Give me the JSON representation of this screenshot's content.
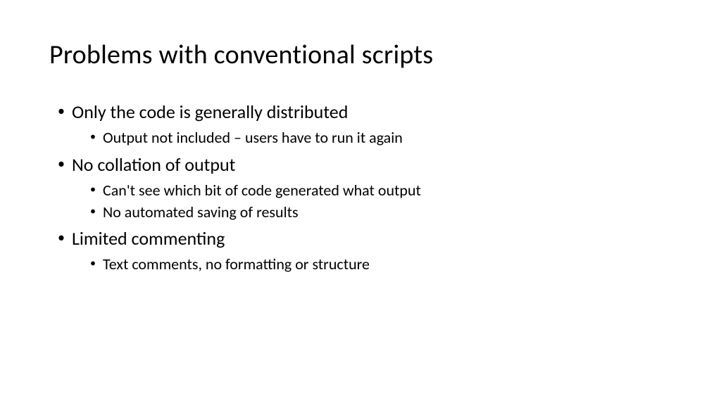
{
  "slide": {
    "title": "Problems with conventional scripts",
    "points": [
      {
        "text": "Only the code is generally distributed",
        "subs": [
          "Output not included – users have to run it again"
        ]
      },
      {
        "text": "No collation of output",
        "subs": [
          "Can't see which bit of code generated what output",
          "No automated saving of results"
        ]
      },
      {
        "text": "Limited commenting",
        "subs": [
          "Text comments, no formatting or structure"
        ]
      }
    ]
  }
}
